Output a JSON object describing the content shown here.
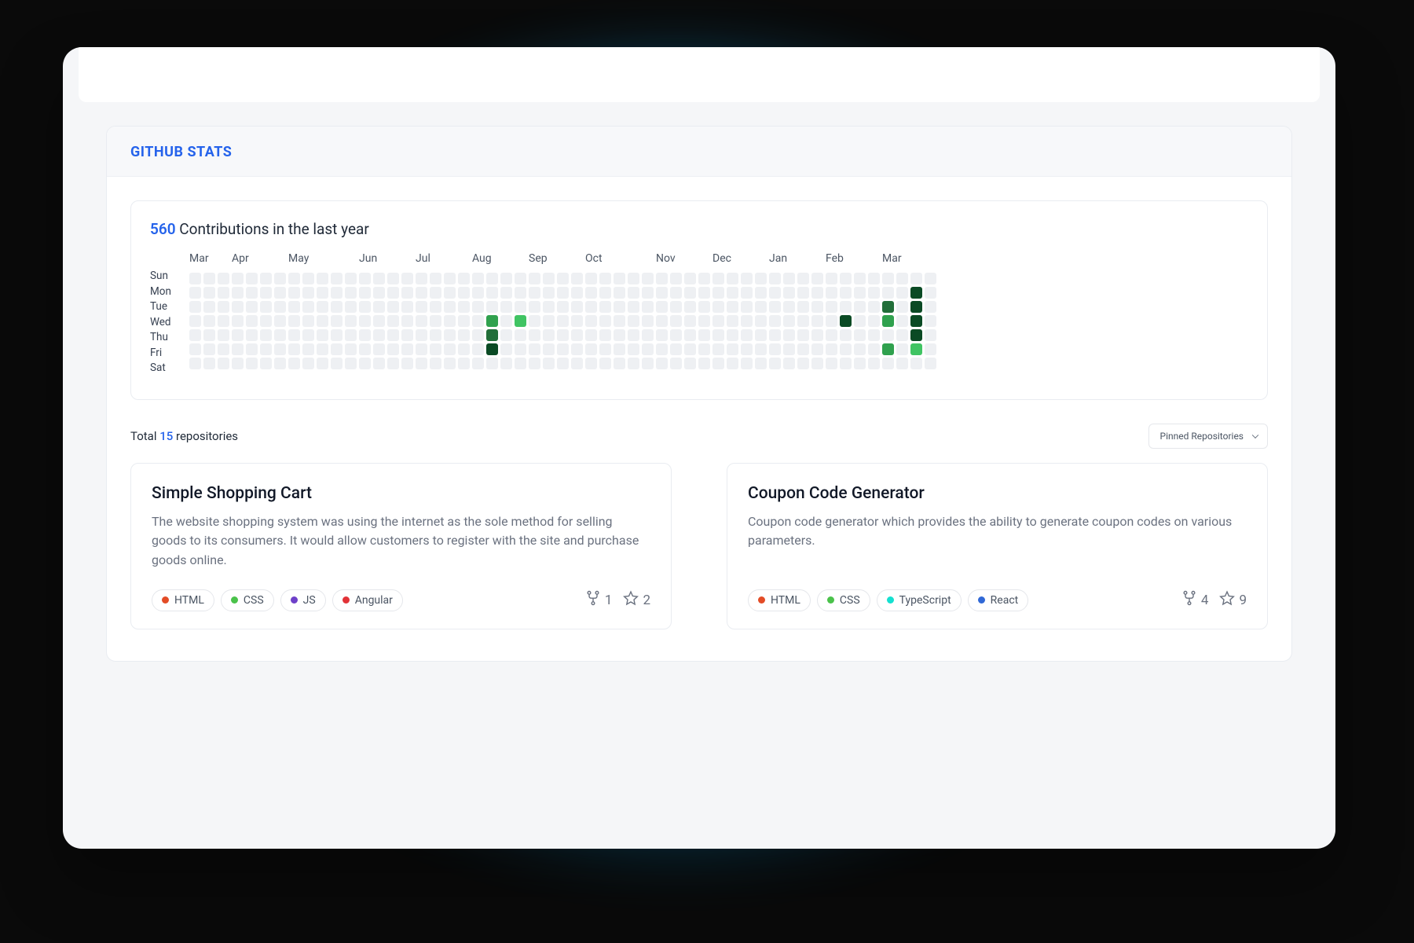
{
  "section": {
    "title": "GITHUB STATS"
  },
  "contributions": {
    "count_label": "560",
    "suffix_label": "Contributions in the last year",
    "months": [
      {
        "label": "Mar",
        "col": 0
      },
      {
        "label": "Apr",
        "col": 3
      },
      {
        "label": "May",
        "col": 7
      },
      {
        "label": "Jun",
        "col": 12
      },
      {
        "label": "Jul",
        "col": 16
      },
      {
        "label": "Aug",
        "col": 20
      },
      {
        "label": "Sep",
        "col": 24
      },
      {
        "label": "Oct",
        "col": 28
      },
      {
        "label": "Nov",
        "col": 33
      },
      {
        "label": "Dec",
        "col": 37
      },
      {
        "label": "Jan",
        "col": 41
      },
      {
        "label": "Feb",
        "col": 45
      },
      {
        "label": "Mar",
        "col": 49
      }
    ],
    "days": [
      "Sun",
      "Mon",
      "Tue",
      "Wed",
      "Thu",
      "Fri",
      "Sat"
    ],
    "total_weeks": 53,
    "activity": [
      {
        "week": 21,
        "day": 3,
        "level": 2
      },
      {
        "week": 21,
        "day": 4,
        "level": 3
      },
      {
        "week": 21,
        "day": 5,
        "level": 4
      },
      {
        "week": 23,
        "day": 3,
        "level": 1
      },
      {
        "week": 46,
        "day": 3,
        "level": 4
      },
      {
        "week": 49,
        "day": 2,
        "level": 3
      },
      {
        "week": 49,
        "day": 3,
        "level": 2
      },
      {
        "week": 49,
        "day": 5,
        "level": 2
      },
      {
        "week": 51,
        "day": 1,
        "level": 4
      },
      {
        "week": 51,
        "day": 2,
        "level": 4
      },
      {
        "week": 51,
        "day": 3,
        "level": 4
      },
      {
        "week": 51,
        "day": 4,
        "level": 4
      },
      {
        "week": 51,
        "day": 5,
        "level": 1
      }
    ]
  },
  "repo_summary": {
    "prefix": "Total",
    "count": "15",
    "suffix": "repositories",
    "dropdown_label": "Pinned Repositories"
  },
  "repositories": [
    {
      "title": "Simple Shopping Cart",
      "description": "The website shopping system was using the internet as the sole method for selling goods to its consumers. It would allow customers to register with the site and purchase goods online.",
      "languages": [
        {
          "name": "HTML",
          "color": "#e34c26"
        },
        {
          "name": "CSS",
          "color": "#4ac24a"
        },
        {
          "name": "JS",
          "color": "#6e40c9"
        },
        {
          "name": "Angular",
          "color": "#e23237"
        }
      ],
      "forks": "1",
      "stars": "2"
    },
    {
      "title": "Coupon Code Generator",
      "description": "Coupon code generator which provides the ability to generate coupon codes on various parameters.",
      "languages": [
        {
          "name": "HTML",
          "color": "#e34c26"
        },
        {
          "name": "CSS",
          "color": "#4ac24a"
        },
        {
          "name": "TypeScript",
          "color": "#14e0d0"
        },
        {
          "name": "React",
          "color": "#3068d6"
        }
      ],
      "forks": "4",
      "stars": "9"
    }
  ]
}
